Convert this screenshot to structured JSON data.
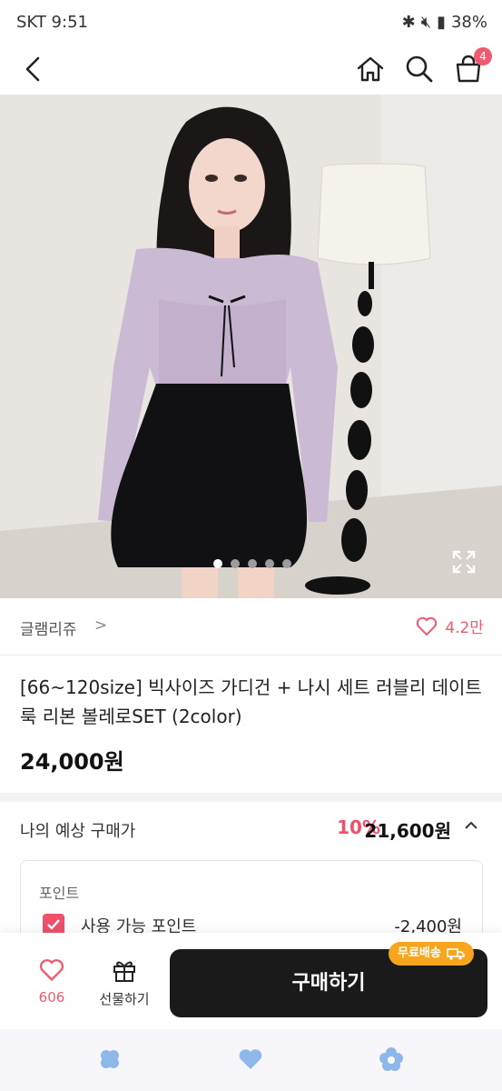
{
  "status_bar": {
    "carrier_time": "SKT 9:51",
    "battery": "38%"
  },
  "header": {
    "cart_count": "4"
  },
  "product_image": {
    "slide_count": 5,
    "active_slide": 1
  },
  "seller": {
    "name": "글램리쥬",
    "chevron": ">",
    "likes": "4.2만"
  },
  "product": {
    "title": "[66~120size] 빅사이즈 가디건 + 나시 세트 러블리 데이트룩 리본 볼레로SET (2color)",
    "price": "24,000원"
  },
  "expected_price": {
    "label": "나의 예상 구매가",
    "discount": "10%",
    "amount": "21,600원"
  },
  "points": {
    "section_label": "포인트",
    "usable_label": "사용 가능 포인트",
    "usable_amount": "-2,400원"
  },
  "bottom_bar": {
    "like_count": "606",
    "gift_label": "선물하기",
    "buy_label": "구매하기",
    "free_ship_label": "무료배송"
  },
  "colors": {
    "accent": "#f05a6e",
    "buy_button": "#1a1a1a",
    "free_ship": "#f7a51c"
  }
}
